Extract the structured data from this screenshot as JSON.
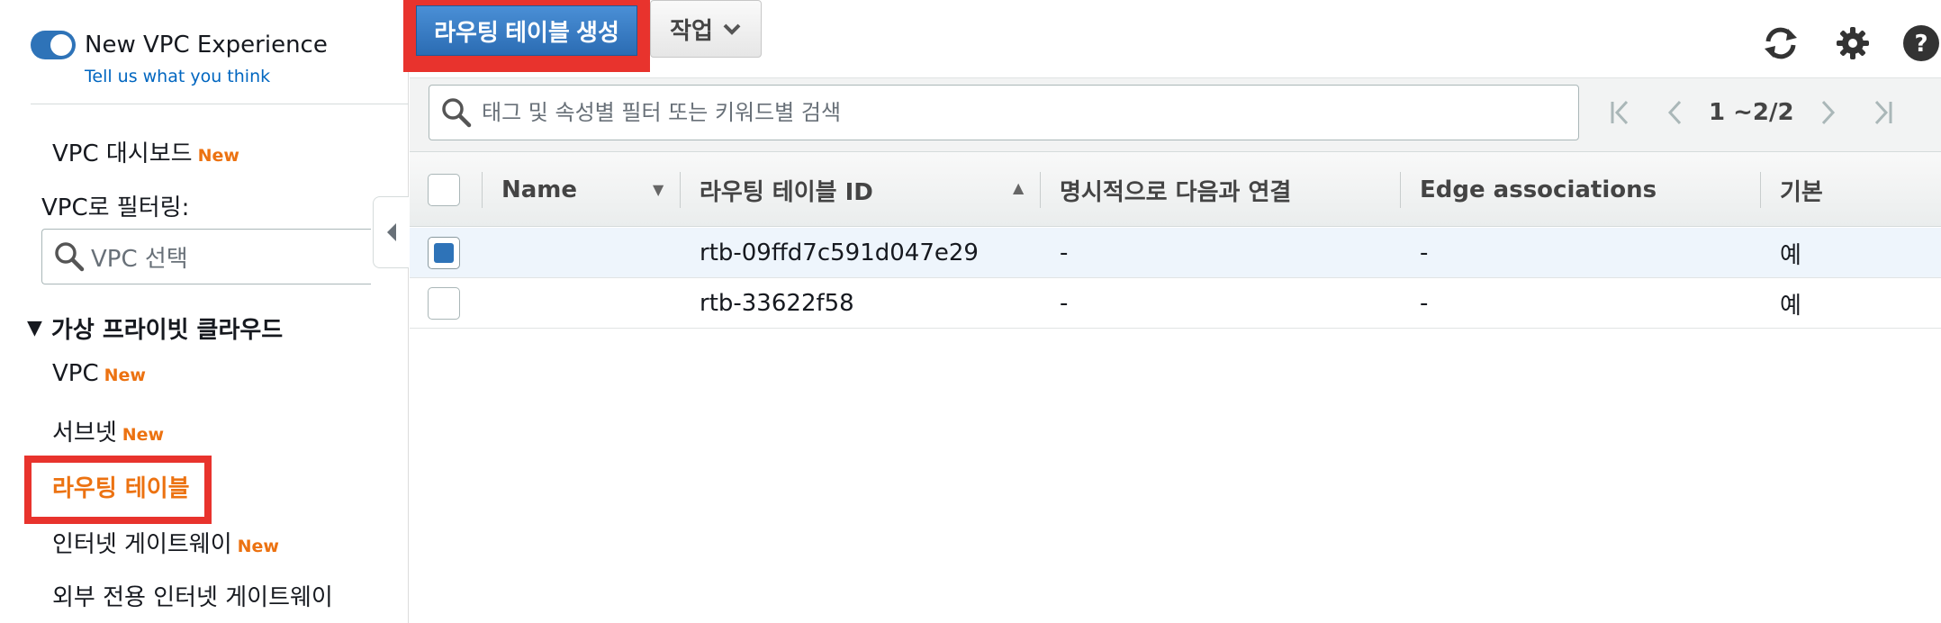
{
  "sidebar": {
    "toggle_label": "New VPC Experience",
    "feedback_link": "Tell us what you think",
    "dashboard": {
      "label": "VPC 대시보드",
      "badge": "New"
    },
    "filter_label": "VPC로 필터링:",
    "vpc_select_placeholder": "VPC 선택",
    "section_title": "가상 프라이빗 클라우드",
    "items": [
      {
        "label": "VPC",
        "badge": "New"
      },
      {
        "label": "서브넷",
        "badge": "New"
      },
      {
        "label": "라우팅 테이블",
        "badge": ""
      },
      {
        "label": "인터넷 게이트웨이",
        "badge": "New"
      },
      {
        "label": "외부 전용 인터넷 게이트웨이",
        "badge": ""
      }
    ]
  },
  "toolbar": {
    "create_label": "라우팅 테이블 생성",
    "actions_label": "작업"
  },
  "search": {
    "placeholder": "태그 및 속성별 필터 또는 키워드별 검색",
    "value": ""
  },
  "pagination": {
    "range_text": "1 ~2/2"
  },
  "table": {
    "columns": [
      "Name",
      "라우팅 테이블 ID",
      "명시적으로 다음과 연결",
      "Edge associations",
      "기본"
    ],
    "rows": [
      {
        "selected": true,
        "name": "",
        "id": "rtb-09ffd7c591d047e29",
        "explicit": "-",
        "edge": "-",
        "main": "예"
      },
      {
        "selected": false,
        "name": "",
        "id": "rtb-33622f58",
        "explicit": "-",
        "edge": "-",
        "main": "예"
      }
    ]
  },
  "colors": {
    "primary": "#2e73b8",
    "accent_orange": "#ec7211",
    "highlight_red": "#e8332d",
    "link_blue": "#0066c0"
  }
}
